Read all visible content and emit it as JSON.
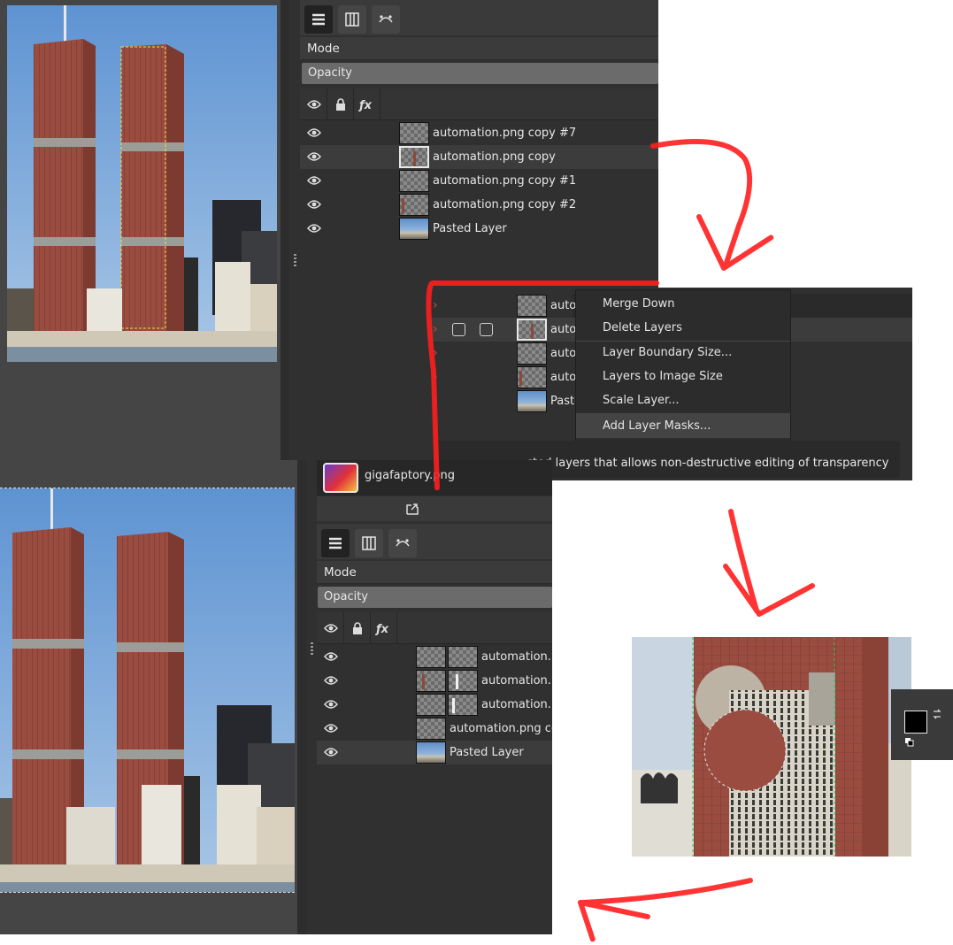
{
  "top_panel": {
    "mode_label": "Mode",
    "opacity_label": "Opacity",
    "layers": [
      {
        "name": "automation.png copy #7",
        "selected": false
      },
      {
        "name": "automation.png copy",
        "selected": true
      },
      {
        "name": "automation.png copy #1",
        "selected": false
      },
      {
        "name": "automation.png copy #2",
        "selected": false
      },
      {
        "name": "Pasted Layer",
        "selected": false
      }
    ]
  },
  "context_menu": {
    "truncated_rows": [
      "auto",
      "auto",
      "auto",
      "auto",
      "Paste"
    ],
    "items": [
      {
        "label": "Merge Down"
      },
      {
        "label": "Delete Layers"
      },
      {
        "label": "Layer Boundary Size..."
      },
      {
        "label": "Layers to Image Size"
      },
      {
        "label": "Scale Layer..."
      },
      {
        "label": "Add Layer Masks..."
      }
    ],
    "tooltip": "cted layers that allows non-destructive editing of transparency"
  },
  "bottom_panel": {
    "image_tab_name": "gigafaptory.png",
    "mode_label": "Mode",
    "opacity_label": "Opacity",
    "layers": [
      {
        "name": "automation.p",
        "selected": false
      },
      {
        "name": "automation.p",
        "selected": false
      },
      {
        "name": "automation.p",
        "selected": false
      },
      {
        "name": "automation.png co",
        "selected": false
      },
      {
        "name": "Pasted Layer",
        "selected": true
      }
    ]
  },
  "colors": {
    "annotation_arrow": "#ff2020",
    "fg_color": "#000000",
    "bg_color": "#ffffff"
  }
}
